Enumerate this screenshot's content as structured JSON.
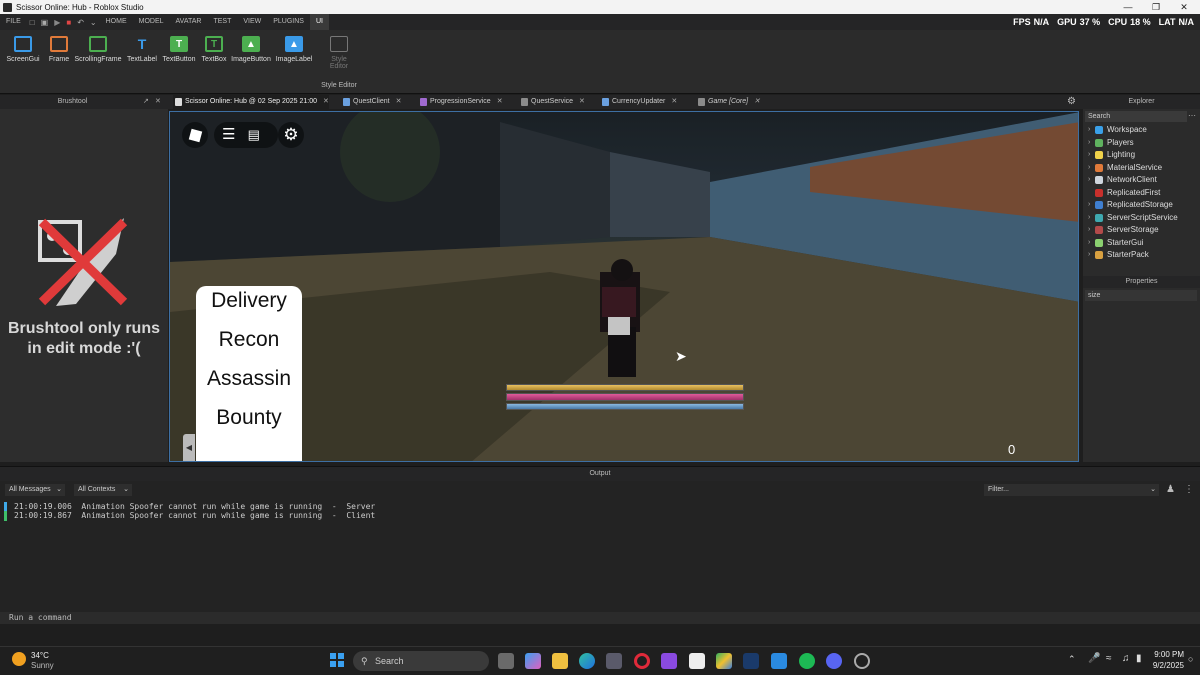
{
  "window": {
    "title": "Scissor Online: Hub - Roblox Studio"
  },
  "menu": {
    "items": [
      "FILE",
      "HOME",
      "MODEL",
      "AVATAR",
      "TEST",
      "VIEW",
      "PLUGINS",
      "UI"
    ],
    "active": "UI"
  },
  "stats": {
    "fps_label": "FPS",
    "fps_value": "N/A",
    "gpu_label": "GPU",
    "gpu_value": "37 %",
    "cpu_label": "CPU",
    "cpu_value": "18 %",
    "lat_label": "LAT",
    "lat_value": "N/A"
  },
  "toolbar": {
    "buttons": [
      "ScreenGui",
      "Frame",
      "ScrollingFrame",
      "TextLabel",
      "TextButton",
      "TextBox",
      "ImageButton",
      "ImageLabel"
    ],
    "style_editor_label": "Style Editor",
    "group_label": "Style Editor"
  },
  "brushtool": {
    "title": "Brushtool",
    "message": "Brushtool only runs in edit mode :'("
  },
  "tabs": [
    {
      "label": "Scissor Online: Hub @ 02 Sep 2025 21:00"
    },
    {
      "label": "QuestClient"
    },
    {
      "label": "ProgressionService"
    },
    {
      "label": "QuestService"
    },
    {
      "label": "CurrencyUpdater"
    },
    {
      "label": "Game [Core]"
    }
  ],
  "viewport": {
    "quest_options": [
      "Delivery",
      "Recon",
      "Assassin",
      "Bounty"
    ],
    "counter": "0"
  },
  "explorer": {
    "title": "Explorer",
    "search_placeholder": "Search",
    "items": [
      {
        "label": "Workspace",
        "color": "#3aa0e8"
      },
      {
        "label": "Players",
        "color": "#5fb25f"
      },
      {
        "label": "Lighting",
        "color": "#f0d24a"
      },
      {
        "label": "MaterialService",
        "color": "#e07a3a"
      },
      {
        "label": "NetworkClient",
        "color": "#cfd6de"
      },
      {
        "label": "ReplicatedFirst",
        "color": "#c9302c"
      },
      {
        "label": "ReplicatedStorage",
        "color": "#3f7fd0"
      },
      {
        "label": "ServerScriptService",
        "color": "#3fa9b0"
      },
      {
        "label": "ServerStorage",
        "color": "#b34a4a"
      },
      {
        "label": "StarterGui",
        "color": "#8bd070"
      },
      {
        "label": "StarterPack",
        "color": "#d8a040"
      }
    ]
  },
  "properties": {
    "title": "Properties",
    "filter_value": "size"
  },
  "output": {
    "title": "Output",
    "filter_messages": "All Messages",
    "filter_contexts": "All Contexts",
    "filter_placeholder": "Filter...",
    "lines": [
      {
        "text": "21:00:19.006  Animation Spoofer cannot run while game is running  -  Server",
        "color": "#3fa9e8"
      },
      {
        "text": "21:00:19.867  Animation Spoofer cannot run while game is running  -  Client",
        "color": "#3fc06a"
      }
    ]
  },
  "command_bar": {
    "placeholder": "Run a command"
  },
  "taskbar": {
    "weather_temp": "34°C",
    "weather_desc": "Sunny",
    "search_label": "Search",
    "time": "9:00 PM",
    "date": "9/2/2025"
  }
}
